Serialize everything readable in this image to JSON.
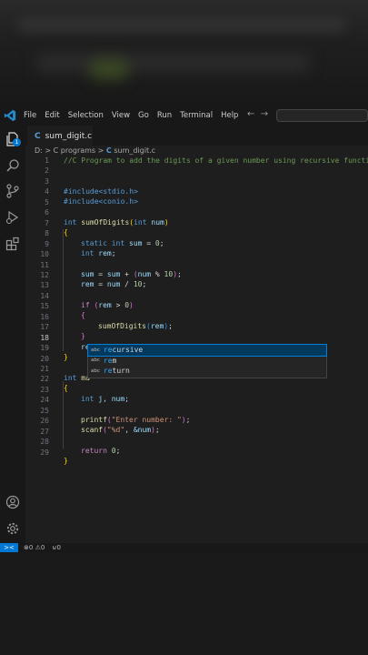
{
  "menu": [
    "File",
    "Edit",
    "Selection",
    "View",
    "Go",
    "Run",
    "Terminal",
    "Help"
  ],
  "tab": {
    "lang_icon": "C",
    "filename": "sum_digit.c"
  },
  "breadcrumb": {
    "drive": "D:",
    "sep": ">",
    "folder": "C programs",
    "file_icon": "C",
    "file": "sum_digit.c"
  },
  "explorer_badge": "1",
  "code_lines": [
    {
      "n": "1"
    },
    {
      "n": "2"
    },
    {
      "n": "3"
    },
    {
      "n": "4"
    },
    {
      "n": "5"
    },
    {
      "n": "6"
    },
    {
      "n": "7"
    },
    {
      "n": "8"
    },
    {
      "n": "9"
    },
    {
      "n": "10"
    },
    {
      "n": "11"
    },
    {
      "n": "12"
    },
    {
      "n": "13"
    },
    {
      "n": "14"
    },
    {
      "n": "15"
    },
    {
      "n": "16"
    },
    {
      "n": "17"
    },
    {
      "n": "18"
    },
    {
      "n": "19"
    },
    {
      "n": "20"
    },
    {
      "n": "21"
    },
    {
      "n": "22"
    },
    {
      "n": "23"
    },
    {
      "n": "24"
    },
    {
      "n": "25"
    },
    {
      "n": "26"
    },
    {
      "n": "27"
    },
    {
      "n": "28"
    },
    {
      "n": "29"
    }
  ],
  "code": {
    "l1": "//C Program to add the digits of a given number using recursive function",
    "l3": "#include<stdio.h>",
    "l4": "#include<conio.h>",
    "l6_kw": "int",
    "l6_fn": "sumOfDigits",
    "l6_kw2": "int",
    "l6_var": "num",
    "l7": "{",
    "l8_kw": "static int",
    "l8_var": "sum",
    "l8_num": "0",
    "l9_kw": "int",
    "l9_var": "rem",
    "l11_var": "sum",
    "l11_var2": "sum",
    "l11_var3": "num",
    "l11_num": "10",
    "l12_var": "rem",
    "l12_var2": "num",
    "l12_num": "10",
    "l14_kw": "if",
    "l14_var": "rem",
    "l14_num": "0",
    "l15": "{",
    "l16_fn": "sumOfDigits",
    "l16_var": "rem",
    "l17": "}",
    "l18": "re",
    "l19": "}",
    "l21_kw": "int",
    "l21_fn": "ma",
    "l22": "{",
    "l23_kw": "int",
    "l23_var": "j, num;",
    "l25_fn": "printf",
    "l25_str": "\"Enter number: \"",
    "l26_fn": "scanf",
    "l26_str": "\"%d\"",
    "l26_var": "&num",
    "l28_kw": "return",
    "l28_num": "0",
    "l29": "}"
  },
  "suggestions": [
    {
      "kind": "abc",
      "match": "re",
      "rest": "cursive"
    },
    {
      "kind": "abc",
      "match": "re",
      "rest": "m"
    },
    {
      "kind": "abc",
      "match": "re",
      "rest": "turn"
    }
  ],
  "status": {
    "remote": "><",
    "errors": "0",
    "warnings": "0",
    "info": "0"
  }
}
